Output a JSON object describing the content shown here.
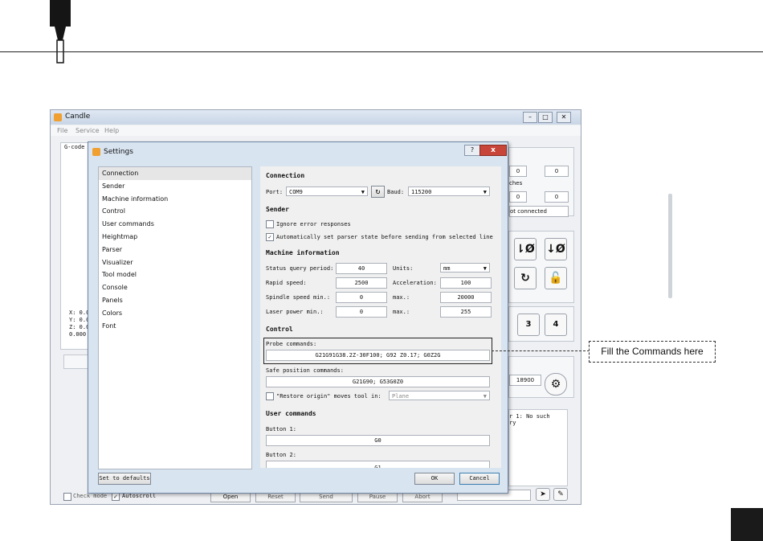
{
  "main_window": {
    "title": "Candle",
    "menu": [
      "File",
      "Service",
      "Help"
    ],
    "gcode_label": "G-code",
    "coords": [
      "X: 0.0",
      "Y: 0.0",
      "Z: 0.0",
      "0.000"
    ],
    "right_values": {
      "r1a": "0",
      "r1b": "0",
      "ches_label": "ches",
      "r2a": "0",
      "r2b": "0",
      "status": "ot connected",
      "speed": "18900"
    },
    "console_text": "r 1: No such\nry",
    "jog_buttons": [
      "3",
      "4"
    ],
    "bottom": {
      "check_mode": "Check mode",
      "autoscroll": "Autoscroll",
      "open": "Open",
      "reset": "Reset",
      "send": "Send",
      "pause": "Pause",
      "abort": "Abort"
    }
  },
  "dialog": {
    "title": "Settings",
    "help": "?",
    "close": "x",
    "nav_items": [
      "Connection",
      "Sender",
      "Machine information",
      "Control",
      "User commands",
      "Heightmap",
      "Parser",
      "Visualizer",
      "Tool model",
      "Console",
      "Panels",
      "Colors",
      "Font"
    ],
    "selected_nav": "Connection",
    "connection": {
      "heading": "Connection",
      "port_label": "Port:",
      "port_value": "COM9",
      "baud_label": "Baud:",
      "baud_value": "115200"
    },
    "sender": {
      "heading": "Sender",
      "ignore_errors": "Ignore error responses",
      "auto_parser": "Automatically set parser state before sending from selected line"
    },
    "machine": {
      "heading": "Machine information",
      "status_query_label": "Status query period:",
      "status_query": "40",
      "units_label": "Units:",
      "units": "mm",
      "rapid_label": "Rapid speed:",
      "rapid": "2500",
      "accel_label": "Acceleration:",
      "accel": "100",
      "spindle_min_label": "Spindle speed min.:",
      "spindle_min": "0",
      "spindle_max_label": "max.:",
      "spindle_max": "20000",
      "laser_min_label": "Laser power min.:",
      "laser_min": "0",
      "laser_max_label": "max.:",
      "laser_max": "255"
    },
    "control": {
      "heading": "Control",
      "probe_label": "Probe commands:",
      "probe_value": "G21G91G38.2Z-30F100; G92 Z0.17; G0Z2G",
      "safe_label": "Safe position commands:",
      "safe_value": "G21G90; G53G0Z0",
      "restore_label": "\"Restore origin\" moves tool in:",
      "restore_value": "Plane"
    },
    "user_commands": {
      "heading": "User commands",
      "button1_label": "Button 1:",
      "button1_value": "G0",
      "button2_label": "Button 2:",
      "button2_value": "G1"
    },
    "set_defaults": "Set to defaults",
    "ok": "OK",
    "cancel": "Cancel"
  },
  "callout": "Fill the Commands here"
}
